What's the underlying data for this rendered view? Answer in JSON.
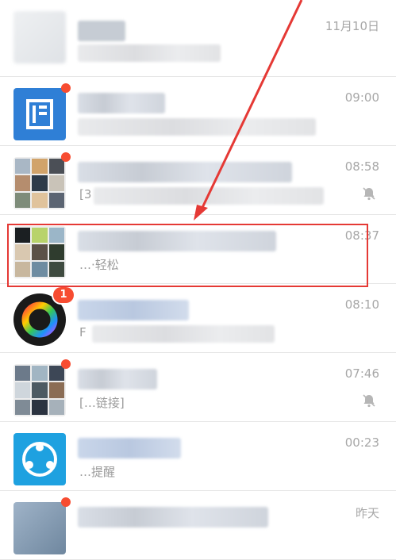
{
  "chats": [
    {
      "time": "11月10日",
      "title_blur_w": 180,
      "preview_blur_w": 180
    },
    {
      "time": "09:00"
    },
    {
      "time": "08:58",
      "muted": true,
      "preview_prefix": "[3"
    },
    {
      "time": "08:37",
      "preview_partial": "…·轻松",
      "highlighted": true
    },
    {
      "time": "08:10",
      "badge": "1",
      "preview_prefix": "F"
    },
    {
      "time": "07:46",
      "muted": true,
      "preview_partial": "[…链接]"
    },
    {
      "time": "00:23",
      "preview_partial": "…提醒"
    },
    {
      "time": "昨天"
    }
  ],
  "colors": {
    "accent_red": "#f74c31",
    "highlight_red": "#e53935",
    "time_gray": "#a7a7a7",
    "app_blue": "#2f7fd6",
    "app_cyan": "#1ea1e0"
  },
  "icons": [
    "mute-bell-icon",
    "wechat-doc-icon",
    "color-wheel-app-icon",
    "share-logo-icon"
  ]
}
